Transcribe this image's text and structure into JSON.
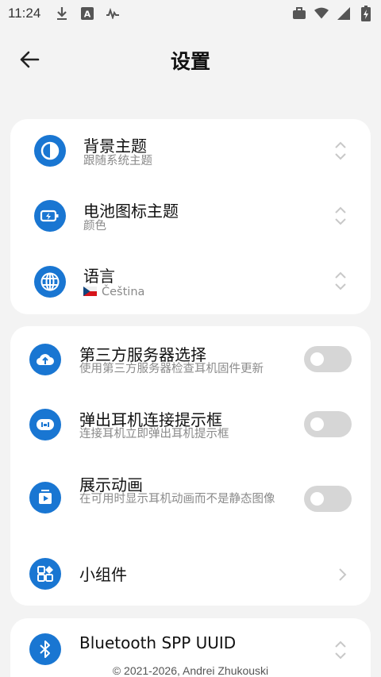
{
  "status_bar": {
    "time": "11:24",
    "left_icons": [
      "download-icon",
      "a-square-icon",
      "signal-pulse-icon"
    ],
    "right_icons": [
      "briefcase-icon",
      "wifi-icon",
      "cell-signal-icon",
      "battery-icon"
    ]
  },
  "header": {
    "title": "设置",
    "back_icon": "arrow-left-icon"
  },
  "colors": {
    "accent": "#1976d2",
    "background": "#f3f3f3",
    "card": "#ffffff",
    "toggle_off": "#d6d6d6"
  },
  "sections": {
    "appearance": {
      "theme": {
        "title": "背景主题",
        "subtitle": "跟随系统主题",
        "icon": "contrast-icon"
      },
      "battery_theme": {
        "title": "电池图标主题",
        "subtitle": "颜色",
        "icon": "battery-charging-icon"
      },
      "language": {
        "title": "语言",
        "subtitle": "Čeština",
        "icon": "globe-icon",
        "flag": "czech-flag-icon"
      }
    },
    "features": {
      "third_party_server": {
        "title": "第三方服务器选择",
        "subtitle": "使用第三方服务器检查耳机固件更新",
        "icon": "cloud-upload-icon",
        "enabled": false
      },
      "connect_popup": {
        "title": "弹出耳机连接提示框",
        "subtitle": "连接耳机立即弹出耳机提示框",
        "icon": "earbuds-icon",
        "enabled": false
      },
      "animation": {
        "title": "展示动画",
        "subtitle": "在可用时显示耳机动画而不是静态图像",
        "icon": "play-icon",
        "enabled": false
      },
      "widgets": {
        "title": "小组件",
        "icon": "widgets-icon"
      }
    },
    "advanced": {
      "spp_uuid": {
        "title": "Bluetooth SPP UUID",
        "icon": "bluetooth-icon"
      }
    }
  },
  "footer": {
    "text": "© 2021-2026, Andrei Zhukouski"
  }
}
